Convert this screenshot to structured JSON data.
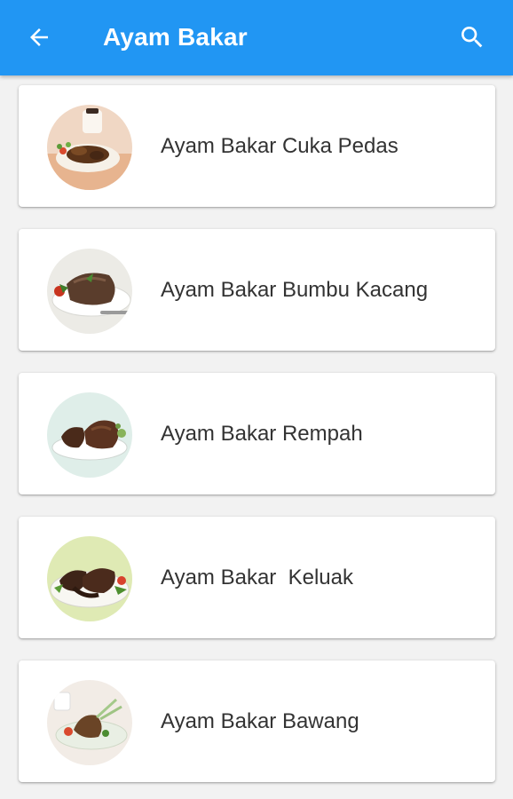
{
  "appbar": {
    "title": "Ayam Bakar",
    "back_icon": "arrow-left-icon",
    "search_icon": "search-icon",
    "color": "#2196f3"
  },
  "recipes": [
    {
      "label": "Ayam Bakar Cuka Pedas"
    },
    {
      "label": "Ayam Bakar Bumbu Kacang"
    },
    {
      "label": "Ayam Bakar Rempah"
    },
    {
      "label": "Ayam Bakar  Keluak"
    },
    {
      "label": "Ayam Bakar Bawang"
    }
  ]
}
